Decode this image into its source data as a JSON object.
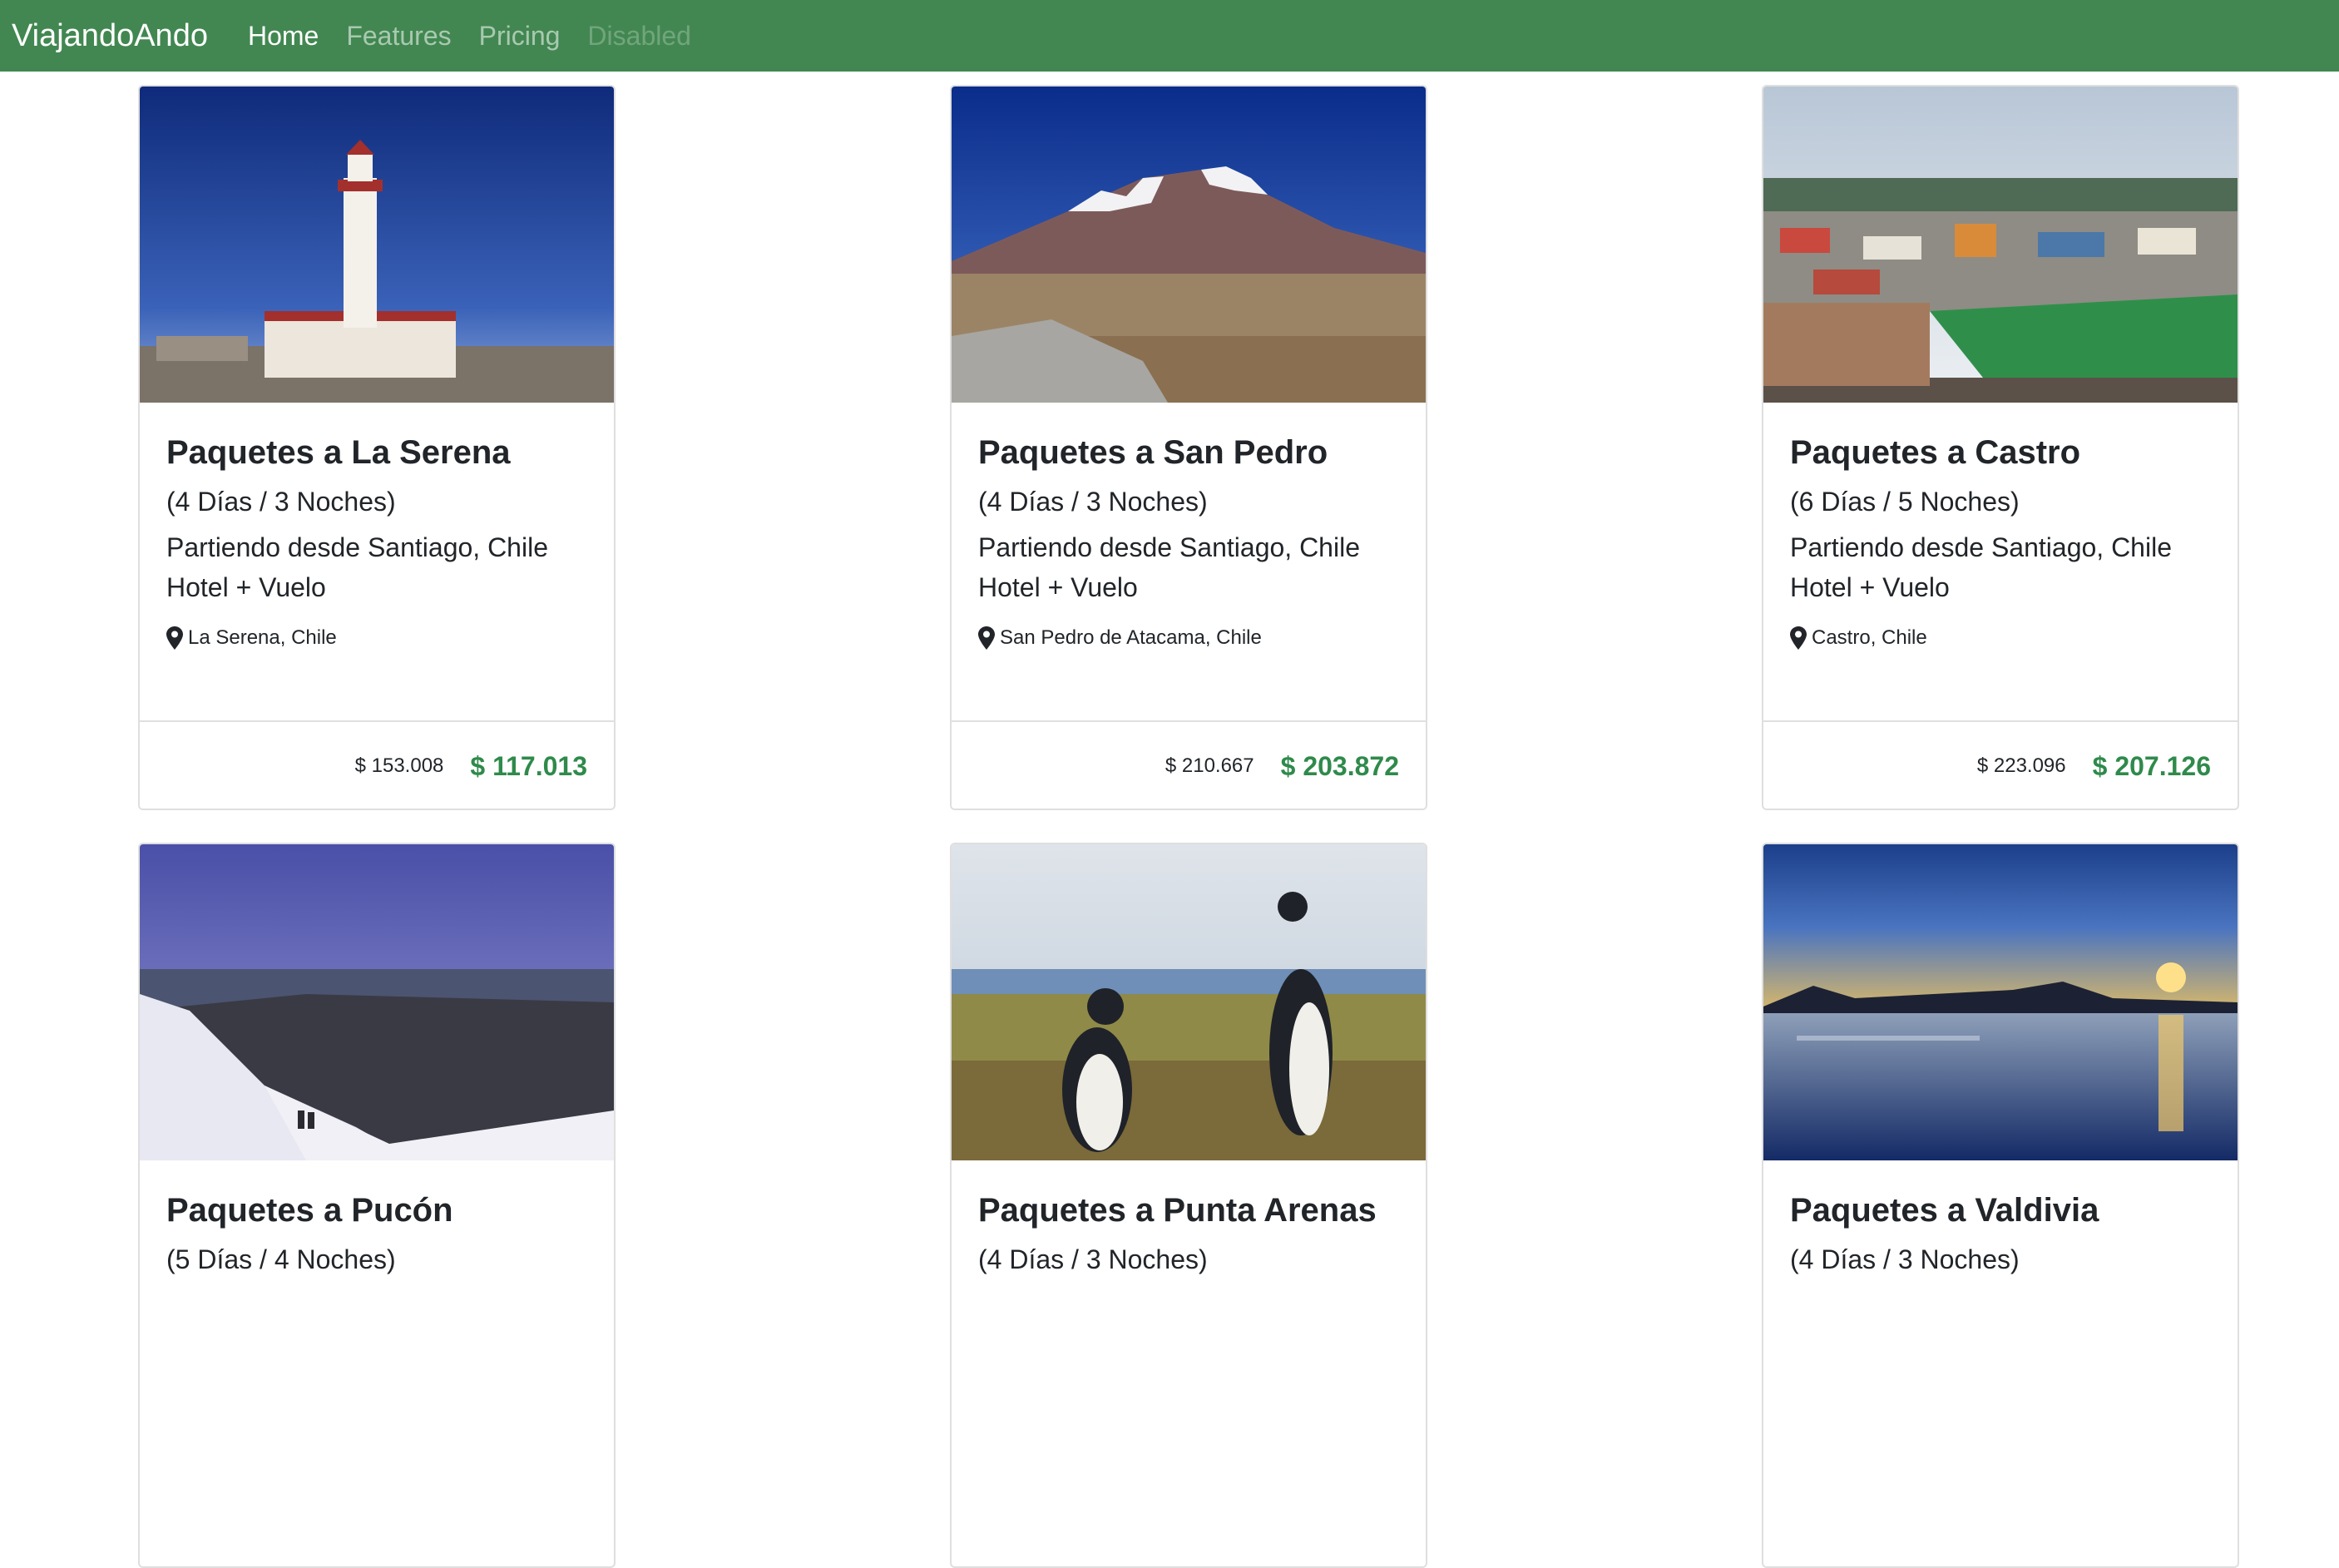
{
  "navbar": {
    "brand": "ViajandoAndo",
    "links": [
      "Home",
      "Features",
      "Pricing",
      "Disabled"
    ]
  },
  "colors": {
    "navbar": "#428751",
    "price": "#2f8a4b"
  },
  "cards": [
    {
      "title": "Paquetes a La Serena",
      "subtitle": "(4 Días / 3 Noches)",
      "line1": "Partiendo desde Santiago, Chile",
      "line2": "Hotel + Vuelo",
      "location": "La Serena, Chile",
      "old_price": "$ 153.008",
      "price": "$ 117.013",
      "image": "lighthouse photo"
    },
    {
      "title": "Paquetes a San Pedro",
      "subtitle": "(4 Días / 3 Noches)",
      "line1": "Partiendo desde Santiago, Chile",
      "line2": "Hotel + Vuelo",
      "location": "San Pedro de Atacama, Chile",
      "old_price": "$ 210.667",
      "price": "$ 203.872",
      "image": "desert volcano photo"
    },
    {
      "title": "Paquetes a Castro",
      "subtitle": "(6 Días / 5 Noches)",
      "line1": "Partiendo desde Santiago, Chile",
      "line2": "Hotel + Vuelo",
      "location": "Castro, Chile",
      "old_price": "$ 223.096",
      "price": "$ 207.126",
      "image": "town with stadium photo"
    },
    {
      "title": "Paquetes a Pucón",
      "subtitle": "(5 Días / 4 Noches)",
      "image": "snowy mountain photo"
    },
    {
      "title": "Paquetes a Punta Arenas",
      "subtitle": "(4 Días / 3 Noches)",
      "image": "penguins photo"
    },
    {
      "title": "Paquetes a Valdivia",
      "subtitle": "(4 Días / 3 Noches)",
      "image": "sunset lake photo"
    }
  ]
}
